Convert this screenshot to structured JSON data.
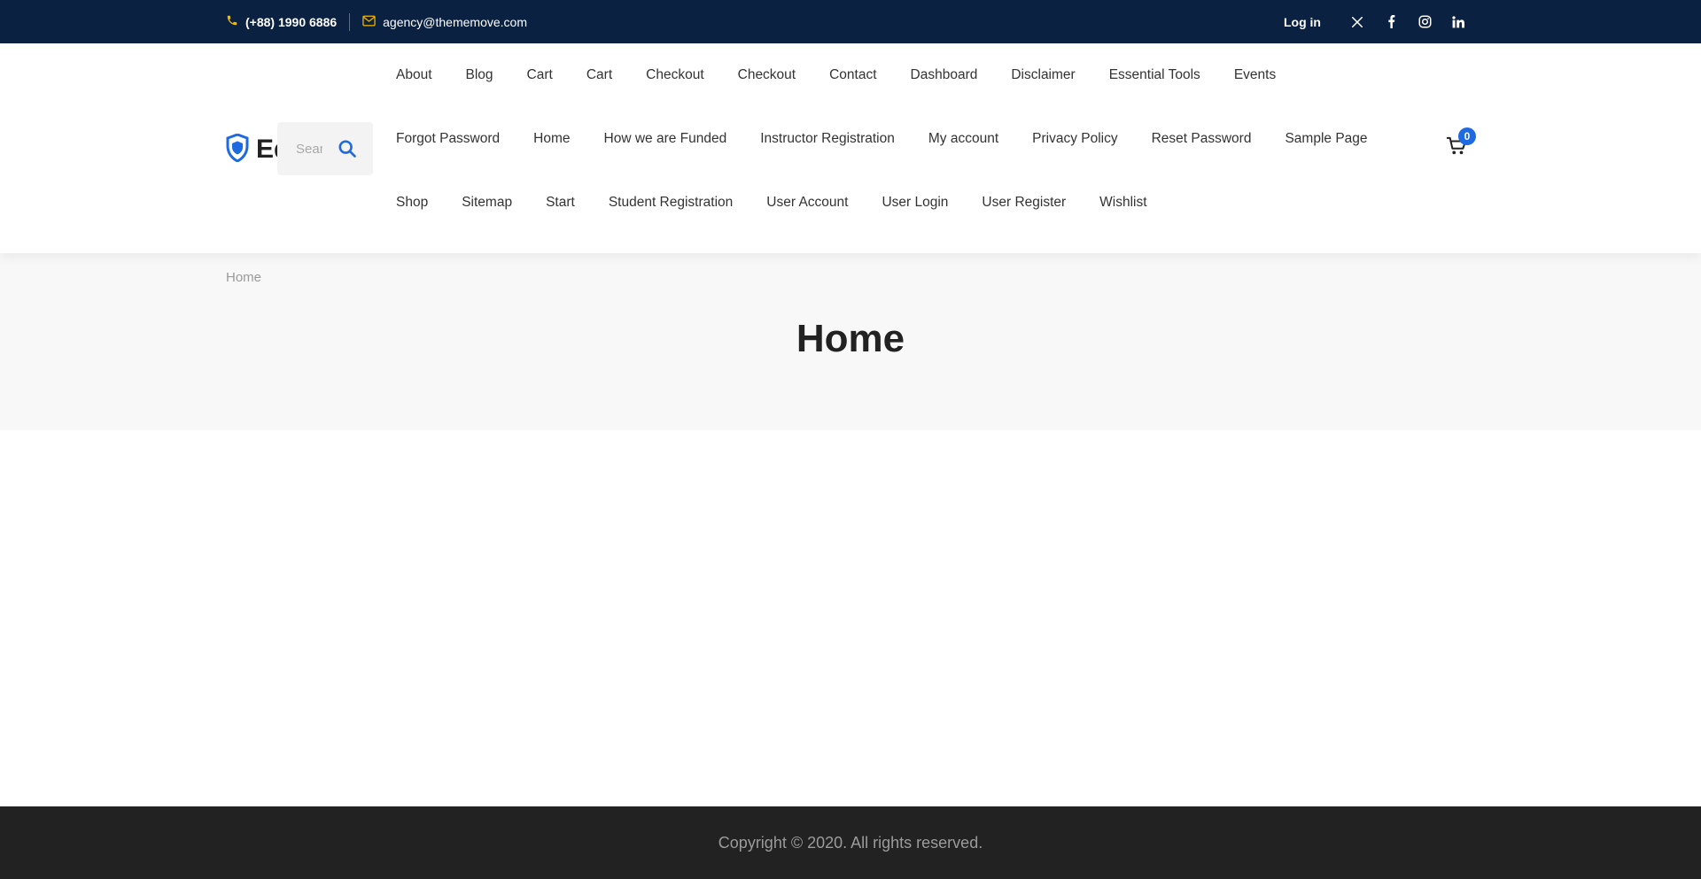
{
  "topbar": {
    "phone": "(+88) 1990 6886",
    "email": "agency@thememove.com",
    "login_label": "Log in",
    "social": [
      "x-icon",
      "facebook-icon",
      "instagram-icon",
      "linkedin-icon"
    ],
    "icon_accent": "#f5b800",
    "background": "#0a2142"
  },
  "header": {
    "logo_text": "Ed",
    "search_placeholder": "Search",
    "nav_row1": [
      "About",
      "Blog",
      "Cart",
      "Cart",
      "Checkout",
      "Checkout",
      "Contact",
      "Dashboard",
      "Disclaimer",
      "Essential Tools",
      "Events"
    ],
    "nav_row2": [
      "Forgot Password",
      "Home",
      "How we are Funded",
      "Instructor Registration",
      "My account",
      "Privacy Policy",
      "Reset Password",
      "Sample Page"
    ],
    "nav_row3": [
      "Shop",
      "Sitemap",
      "Start",
      "Student Registration",
      "User Account",
      "User Login",
      "User Register",
      "Wishlist"
    ],
    "cart_count": "0",
    "accent": "#1f6ae0"
  },
  "page": {
    "breadcrumb": "Home",
    "title": "Home"
  },
  "footer": {
    "copyright": "Copyright © 2020. All rights reserved."
  }
}
